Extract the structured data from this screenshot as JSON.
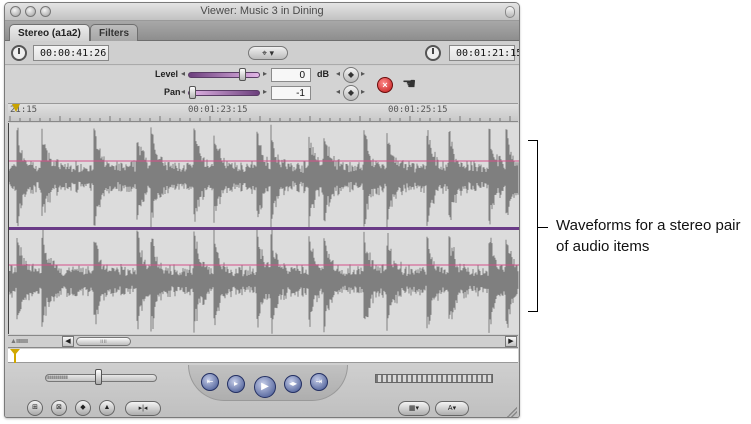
{
  "window": {
    "title": "Viewer: Music 3 in Dining"
  },
  "tabs": [
    {
      "label": "Stereo (a1a2)",
      "selected": true
    },
    {
      "label": "Filters",
      "selected": false
    }
  ],
  "timecode": {
    "duration": "00:00:41:26",
    "current": "00:01:21:15"
  },
  "controls": {
    "level_label": "Level",
    "level_value": "0",
    "level_unit": "dB",
    "level_fraction": 0.8,
    "pan_label": "Pan",
    "pan_value": "-1",
    "pan_fraction": 0.0
  },
  "ruler": {
    "labels": [
      "21:15",
      "00:01:23:15",
      "00:01:25:15"
    ]
  },
  "callout": {
    "text": "Waveforms for a stereo pair of audio items"
  },
  "colors": {
    "waveform": "#7f7f7f",
    "waveform_background": "#dcdcdc",
    "level_line": "#d4508a",
    "channel_divider": "#6a3b87",
    "playhead": "#d1a800"
  },
  "icons": {
    "clock": "clock-icon",
    "reset": "x-circle-icon",
    "drag": "hand-drag-icon",
    "keyframe": "diamond-keyframe-icon"
  }
}
